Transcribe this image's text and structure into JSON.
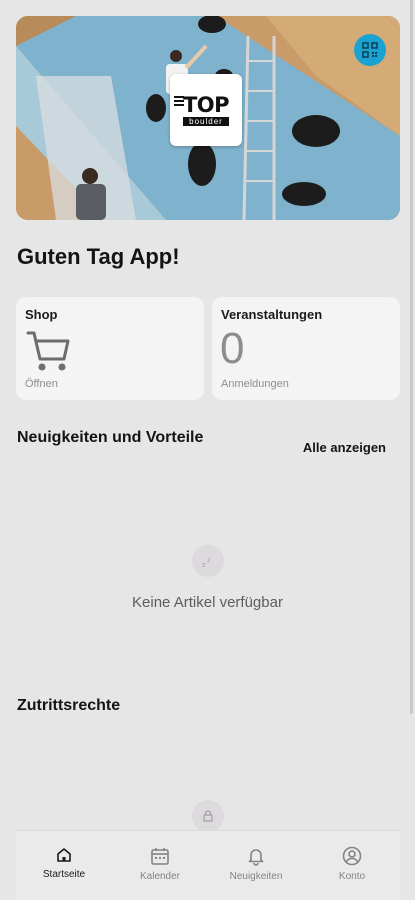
{
  "hero": {
    "logo_text": "TOP",
    "logo_subtext": "boulder",
    "qr_icon": "qr-code-icon"
  },
  "greeting": "Guten Tag App!",
  "cards": {
    "shop": {
      "title": "Shop",
      "subtitle": "Öffnen",
      "icon": "shopping-cart-icon"
    },
    "events": {
      "title": "Veranstaltungen",
      "count": "0",
      "subtitle": "Anmeldungen"
    }
  },
  "news": {
    "title": "Neuigkeiten und Vorteile",
    "show_all": "Alle anzeigen",
    "empty_icon": "sleep-icon",
    "empty_text": "Keine Artikel verfügbar"
  },
  "access": {
    "title": "Zutrittsrechte",
    "icon": "lock-icon"
  },
  "nav": {
    "items": [
      {
        "label": "Startseite",
        "icon": "home-icon",
        "active": true
      },
      {
        "label": "Kalender",
        "icon": "calendar-icon",
        "active": false
      },
      {
        "label": "Neuigkeiten",
        "icon": "bell-icon",
        "active": false
      },
      {
        "label": "Konto",
        "icon": "account-icon",
        "active": false
      }
    ]
  },
  "colors": {
    "background": "#e7e6e7",
    "card": "#f5f4f5",
    "accent": "#1aa3d1",
    "muted_text": "#8e8c8f"
  }
}
